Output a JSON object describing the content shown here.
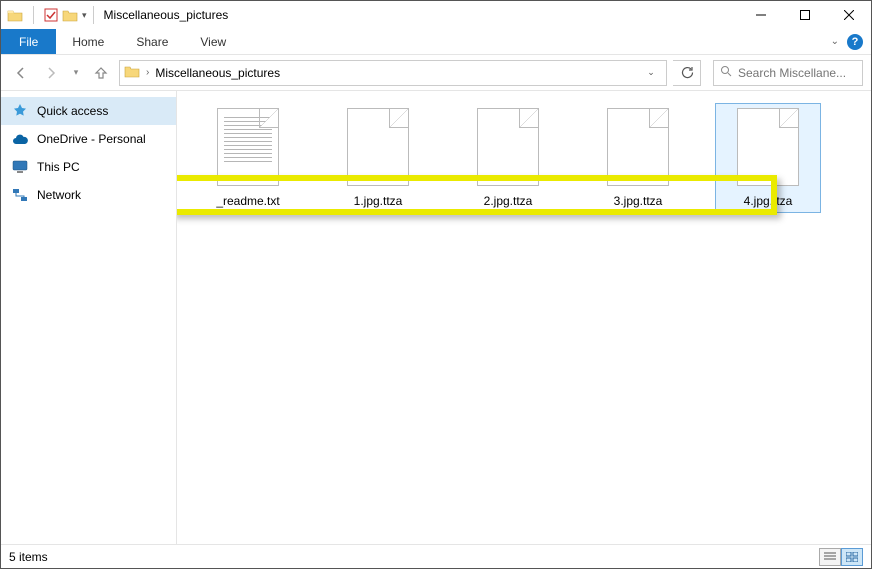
{
  "window": {
    "title": "Miscellaneous_pictures"
  },
  "ribbon": {
    "file": "File",
    "tabs": [
      "Home",
      "Share",
      "View"
    ]
  },
  "address": {
    "folder": "Miscellaneous_pictures"
  },
  "search": {
    "placeholder": "Search Miscellane..."
  },
  "sidebar": {
    "items": [
      {
        "label": "Quick access"
      },
      {
        "label": "OneDrive - Personal"
      },
      {
        "label": "This PC"
      },
      {
        "label": "Network"
      }
    ]
  },
  "files": [
    {
      "label": "_readme.txt",
      "type": "txt"
    },
    {
      "label": "1.jpg.ttza",
      "type": "blank"
    },
    {
      "label": "2.jpg.ttza",
      "type": "blank"
    },
    {
      "label": "3.jpg.ttza",
      "type": "blank"
    },
    {
      "label": "4.jpg.ttza",
      "type": "blank",
      "selected": true
    }
  ],
  "status": {
    "count": "5 items"
  }
}
